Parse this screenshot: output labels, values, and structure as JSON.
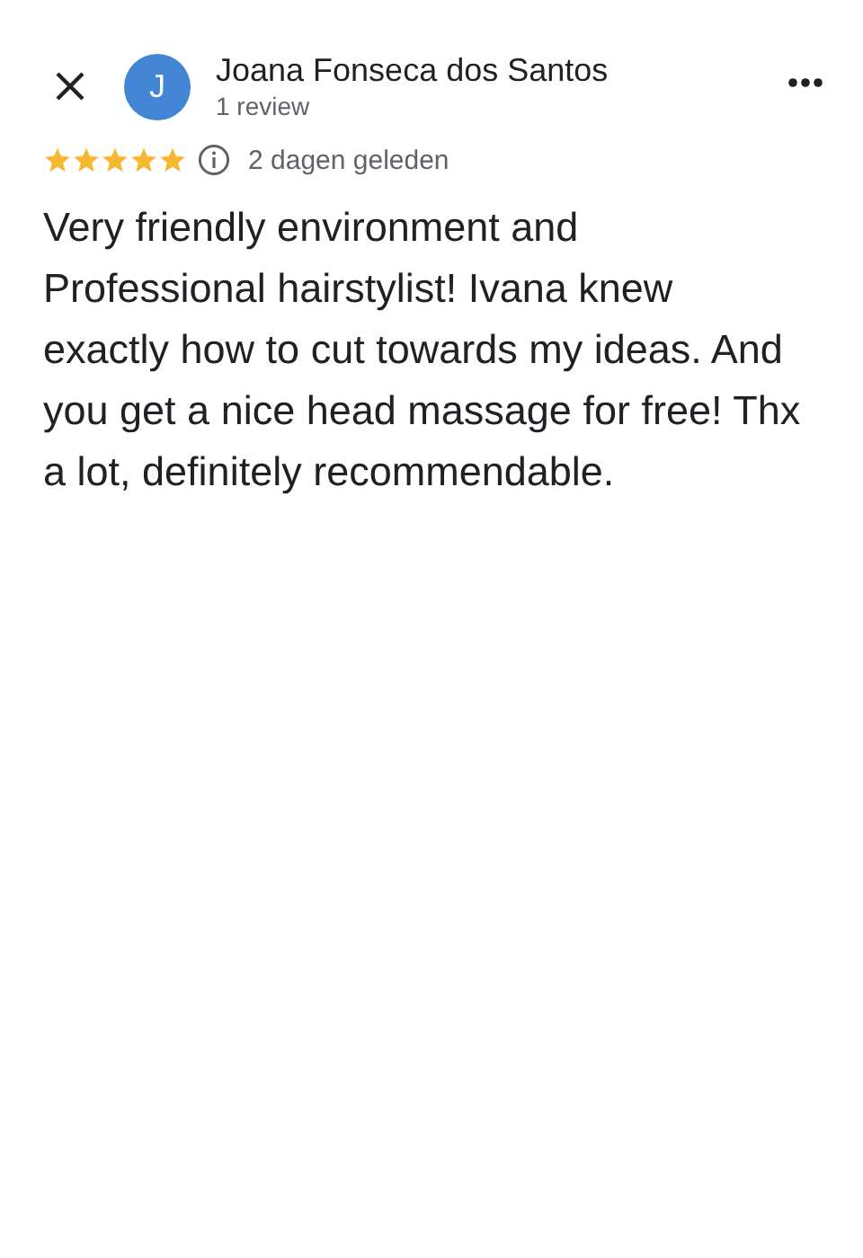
{
  "reviewer": {
    "initial": "J",
    "name": "Joana Fonseca dos Santos",
    "review_count": "1 review"
  },
  "review": {
    "stars": 5,
    "date": "2 dagen geleden",
    "text": "Very friendly environment and Professional hairstylist! Ivana knew exactly how to cut towards my ideas. And you get a nice head massage for free! Thx a lot, definitely recommendable."
  }
}
